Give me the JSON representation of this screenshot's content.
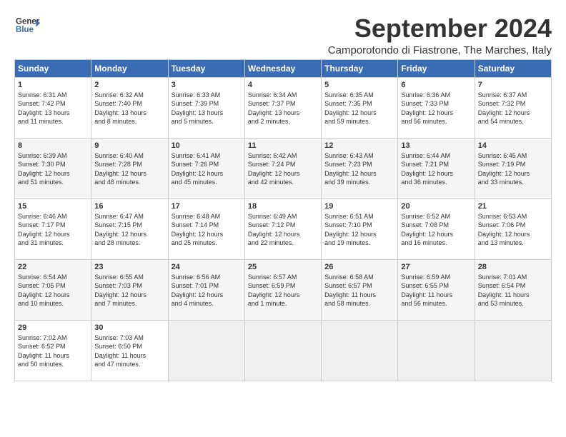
{
  "logo": {
    "line1": "General",
    "line2": "Blue"
  },
  "title": "September 2024",
  "location": "Camporotondo di Fiastrone, The Marches, Italy",
  "weekdays": [
    "Sunday",
    "Monday",
    "Tuesday",
    "Wednesday",
    "Thursday",
    "Friday",
    "Saturday"
  ],
  "weeks": [
    [
      {
        "day": "1",
        "info": "Sunrise: 6:31 AM\nSunset: 7:42 PM\nDaylight: 13 hours\nand 11 minutes."
      },
      {
        "day": "2",
        "info": "Sunrise: 6:32 AM\nSunset: 7:40 PM\nDaylight: 13 hours\nand 8 minutes."
      },
      {
        "day": "3",
        "info": "Sunrise: 6:33 AM\nSunset: 7:39 PM\nDaylight: 13 hours\nand 5 minutes."
      },
      {
        "day": "4",
        "info": "Sunrise: 6:34 AM\nSunset: 7:37 PM\nDaylight: 13 hours\nand 2 minutes."
      },
      {
        "day": "5",
        "info": "Sunrise: 6:35 AM\nSunset: 7:35 PM\nDaylight: 12 hours\nand 59 minutes."
      },
      {
        "day": "6",
        "info": "Sunrise: 6:36 AM\nSunset: 7:33 PM\nDaylight: 12 hours\nand 56 minutes."
      },
      {
        "day": "7",
        "info": "Sunrise: 6:37 AM\nSunset: 7:32 PM\nDaylight: 12 hours\nand 54 minutes."
      }
    ],
    [
      {
        "day": "8",
        "info": "Sunrise: 6:39 AM\nSunset: 7:30 PM\nDaylight: 12 hours\nand 51 minutes."
      },
      {
        "day": "9",
        "info": "Sunrise: 6:40 AM\nSunset: 7:28 PM\nDaylight: 12 hours\nand 48 minutes."
      },
      {
        "day": "10",
        "info": "Sunrise: 6:41 AM\nSunset: 7:26 PM\nDaylight: 12 hours\nand 45 minutes."
      },
      {
        "day": "11",
        "info": "Sunrise: 6:42 AM\nSunset: 7:24 PM\nDaylight: 12 hours\nand 42 minutes."
      },
      {
        "day": "12",
        "info": "Sunrise: 6:43 AM\nSunset: 7:23 PM\nDaylight: 12 hours\nand 39 minutes."
      },
      {
        "day": "13",
        "info": "Sunrise: 6:44 AM\nSunset: 7:21 PM\nDaylight: 12 hours\nand 36 minutes."
      },
      {
        "day": "14",
        "info": "Sunrise: 6:45 AM\nSunset: 7:19 PM\nDaylight: 12 hours\nand 33 minutes."
      }
    ],
    [
      {
        "day": "15",
        "info": "Sunrise: 6:46 AM\nSunset: 7:17 PM\nDaylight: 12 hours\nand 31 minutes."
      },
      {
        "day": "16",
        "info": "Sunrise: 6:47 AM\nSunset: 7:15 PM\nDaylight: 12 hours\nand 28 minutes."
      },
      {
        "day": "17",
        "info": "Sunrise: 6:48 AM\nSunset: 7:14 PM\nDaylight: 12 hours\nand 25 minutes."
      },
      {
        "day": "18",
        "info": "Sunrise: 6:49 AM\nSunset: 7:12 PM\nDaylight: 12 hours\nand 22 minutes."
      },
      {
        "day": "19",
        "info": "Sunrise: 6:51 AM\nSunset: 7:10 PM\nDaylight: 12 hours\nand 19 minutes."
      },
      {
        "day": "20",
        "info": "Sunrise: 6:52 AM\nSunset: 7:08 PM\nDaylight: 12 hours\nand 16 minutes."
      },
      {
        "day": "21",
        "info": "Sunrise: 6:53 AM\nSunset: 7:06 PM\nDaylight: 12 hours\nand 13 minutes."
      }
    ],
    [
      {
        "day": "22",
        "info": "Sunrise: 6:54 AM\nSunset: 7:05 PM\nDaylight: 12 hours\nand 10 minutes."
      },
      {
        "day": "23",
        "info": "Sunrise: 6:55 AM\nSunset: 7:03 PM\nDaylight: 12 hours\nand 7 minutes."
      },
      {
        "day": "24",
        "info": "Sunrise: 6:56 AM\nSunset: 7:01 PM\nDaylight: 12 hours\nand 4 minutes."
      },
      {
        "day": "25",
        "info": "Sunrise: 6:57 AM\nSunset: 6:59 PM\nDaylight: 12 hours\nand 1 minute."
      },
      {
        "day": "26",
        "info": "Sunrise: 6:58 AM\nSunset: 6:57 PM\nDaylight: 11 hours\nand 58 minutes."
      },
      {
        "day": "27",
        "info": "Sunrise: 6:59 AM\nSunset: 6:55 PM\nDaylight: 11 hours\nand 56 minutes."
      },
      {
        "day": "28",
        "info": "Sunrise: 7:01 AM\nSunset: 6:54 PM\nDaylight: 11 hours\nand 53 minutes."
      }
    ],
    [
      {
        "day": "29",
        "info": "Sunrise: 7:02 AM\nSunset: 6:52 PM\nDaylight: 11 hours\nand 50 minutes."
      },
      {
        "day": "30",
        "info": "Sunrise: 7:03 AM\nSunset: 6:50 PM\nDaylight: 11 hours\nand 47 minutes."
      },
      {
        "day": "",
        "info": ""
      },
      {
        "day": "",
        "info": ""
      },
      {
        "day": "",
        "info": ""
      },
      {
        "day": "",
        "info": ""
      },
      {
        "day": "",
        "info": ""
      }
    ]
  ]
}
